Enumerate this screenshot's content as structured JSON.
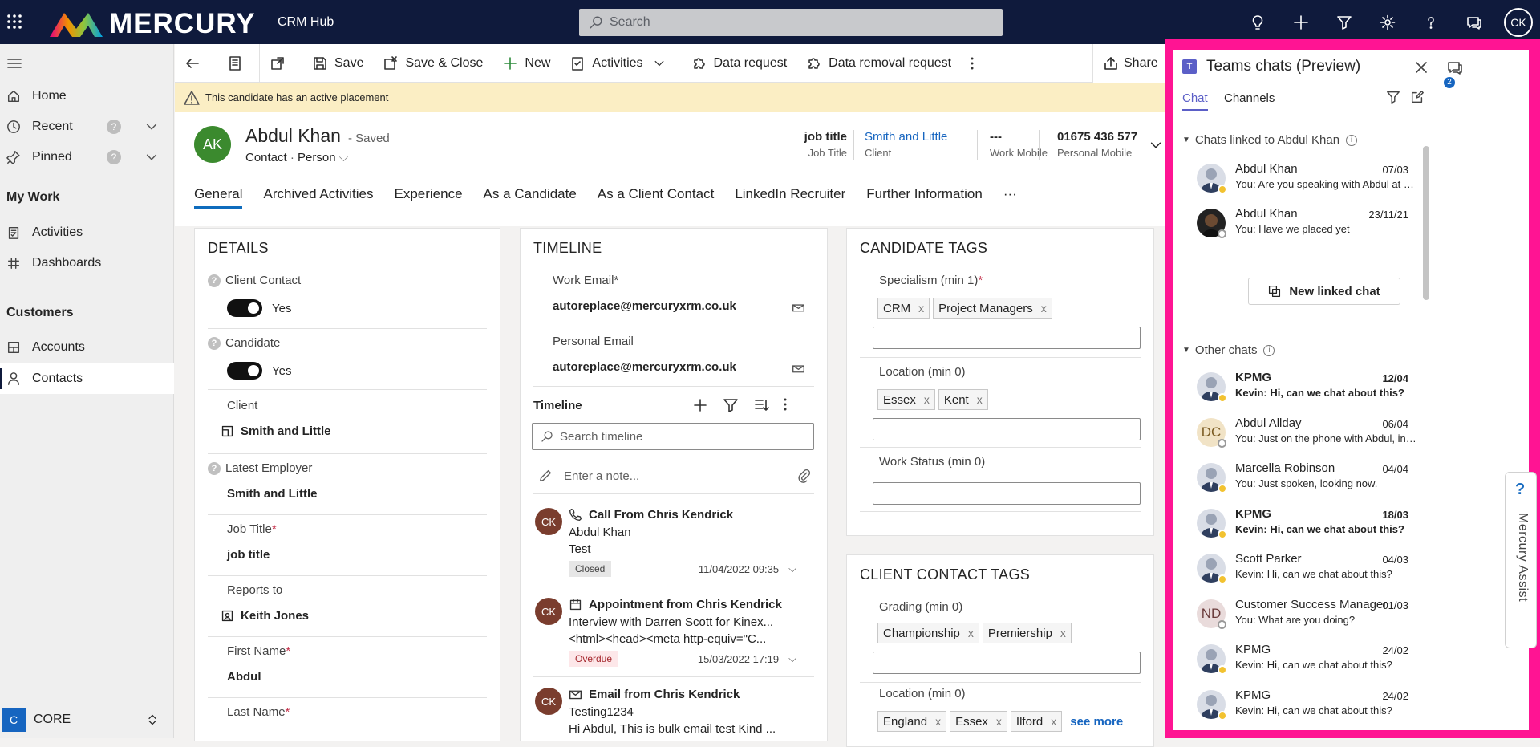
{
  "topbar": {
    "brand": "MERCURY",
    "app_title": "CRM Hub",
    "search_placeholder": "Search",
    "user_initials": "CK"
  },
  "nav": {
    "home": "Home",
    "recent": "Recent",
    "pinned": "Pinned",
    "my_work": "My Work",
    "activities": "Activities",
    "dashboards": "Dashboards",
    "customers": "Customers",
    "accounts": "Accounts",
    "contacts": "Contacts",
    "area_letter": "C",
    "area": "CORE",
    "help_badge": "?"
  },
  "cmd": {
    "save": "Save",
    "save_close": "Save & Close",
    "new": "New",
    "activities": "Activities",
    "data_request": "Data request",
    "data_removal": "Data removal request",
    "share": "Share"
  },
  "warning": "This candidate has an active placement",
  "record": {
    "initials": "AK",
    "name": "Abdul Khan",
    "saved": "- Saved",
    "entity": "Contact",
    "form": "Person",
    "header_fields": [
      {
        "value": "job title",
        "label": "Job Title"
      },
      {
        "value": "Smith and Little",
        "label": "Client"
      },
      {
        "value": "---",
        "label": "Work Mobile"
      },
      {
        "value": "01675 436 577",
        "label": "Personal Mobile"
      }
    ],
    "tabs": [
      "General",
      "Archived Activities",
      "Experience",
      "As a Candidate",
      "As a Client Contact",
      "LinkedIn Recruiter",
      "Further Information",
      "···"
    ]
  },
  "details": {
    "title": "DETAILS",
    "client_contact_label": "Client Contact",
    "client_contact_value": "Yes",
    "candidate_label": "Candidate",
    "candidate_value": "Yes",
    "client_label": "Client",
    "client_value": "Smith and Little",
    "latest_employer_label": "Latest Employer",
    "latest_employer_value": "Smith and Little",
    "job_title_label": "Job Title",
    "job_title_value": "job title",
    "reports_to_label": "Reports to",
    "reports_to_value": "Keith Jones",
    "first_name_label": "First Name",
    "first_name_value": "Abdul",
    "last_name_label": "Last Name"
  },
  "timeline": {
    "title": "TIMELINE",
    "work_email_label": "Work Email",
    "work_email": "autoreplace@mercuryxrm.co.uk",
    "personal_email_label": "Personal Email",
    "personal_email": "autoreplace@mercuryxrm.co.uk",
    "sub_title": "Timeline",
    "search_placeholder": "Search timeline",
    "note_placeholder": "Enter a note...",
    "items": [
      {
        "initials": "CK",
        "title": "Call From Chris Kendrick",
        "line1": "Abdul Khan",
        "line2": "Test",
        "status": "Closed",
        "date": "11/04/2022 09:35"
      },
      {
        "initials": "CK",
        "title": "Appointment from Chris Kendrick",
        "line1": "Interview with Darren Scott for Kinex...",
        "line2": "<html><head><meta http-equiv=\"C...",
        "status": "Overdue",
        "date": "15/03/2022 17:19"
      },
      {
        "initials": "CK",
        "title": "Email from Chris Kendrick",
        "line1": "Testing1234",
        "line2": "Hi Abdul, This is bulk email test Kind ..."
      }
    ]
  },
  "candidate_tags": {
    "title": "CANDIDATE TAGS",
    "specialism_label": "Specialism (min 1)",
    "specialism": [
      "CRM",
      "Project Managers"
    ],
    "location_label": "Location (min 0)",
    "location": [
      "Essex",
      "Kent"
    ],
    "work_status_label": "Work Status (min 0)"
  },
  "client_tags": {
    "title": "CLIENT CONTACT TAGS",
    "grading_label": "Grading (min 0)",
    "grading": [
      "Championship",
      "Premiership"
    ],
    "location_label": "Location (min 0)",
    "location": [
      "England",
      "Essex",
      "Ilford"
    ],
    "see_more": "see more"
  },
  "teams": {
    "title": "Teams chats (Preview)",
    "tab_chat": "Chat",
    "tab_channels": "Channels",
    "linked_section": "Chats linked to Abdul Khan",
    "other_section": "Other chats",
    "new_linked_chat": "New linked chat",
    "assist": "Mercury Assist",
    "badge": "2",
    "linked": [
      {
        "name": "Abdul Khan",
        "date": "07/03",
        "msg": "You: Are you speaking with Abdul at present"
      },
      {
        "name": "Abdul Khan",
        "date": "23/11/21",
        "msg": "You: Have we placed yet"
      }
    ],
    "other": [
      {
        "name": "KPMG",
        "date": "12/04",
        "msg": "Kevin: Hi, can we chat about this?",
        "bold": true
      },
      {
        "name": "Abdul Allday",
        "date": "06/04",
        "msg": "You: Just on the phone with Abdul, interest...",
        "initials": "DC"
      },
      {
        "name": "Marcella Robinson",
        "date": "04/04",
        "msg": "You: Just spoken, looking now."
      },
      {
        "name": "KPMG",
        "date": "18/03",
        "msg": "Kevin: Hi, can we chat about this?",
        "bold": true
      },
      {
        "name": "Scott Parker",
        "date": "04/03",
        "msg": "Kevin: Hi, can we chat about this?"
      },
      {
        "name": "Customer Success Manager",
        "date": "01/03",
        "msg": "You: What are you doing?",
        "initials": "ND"
      },
      {
        "name": "KPMG",
        "date": "24/02",
        "msg": "Kevin: Hi, can we chat about this?"
      },
      {
        "name": "KPMG",
        "date": "24/02",
        "msg": "Kevin: Hi, can we chat about this?"
      }
    ]
  }
}
